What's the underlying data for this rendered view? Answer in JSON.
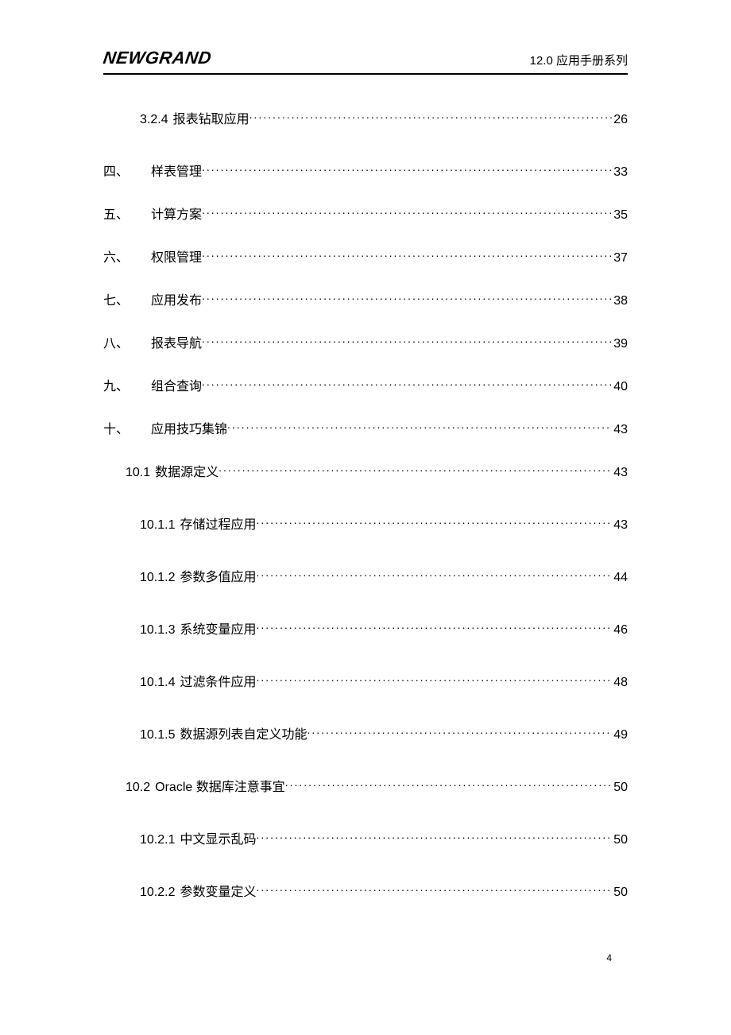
{
  "header": {
    "logo": "NEWGRAND",
    "right": "12.0 应用手册系列"
  },
  "toc": [
    {
      "level": 3,
      "num": "3.2.4",
      "title": "报表钻取应用",
      "page": "26"
    },
    {
      "level": 1,
      "prefix": "四、",
      "title": "样表管理",
      "page": "33"
    },
    {
      "level": 1,
      "prefix": "五、",
      "title": "计算方案",
      "page": "35"
    },
    {
      "level": 1,
      "prefix": "六、",
      "title": "权限管理",
      "page": "37"
    },
    {
      "level": 1,
      "prefix": "七、",
      "title": "应用发布",
      "page": "38"
    },
    {
      "level": 1,
      "prefix": "八、",
      "title": "报表导航",
      "page": "39"
    },
    {
      "level": 1,
      "prefix": "九、",
      "title": "组合查询",
      "page": "40"
    },
    {
      "level": 1,
      "prefix": "十、",
      "title": "应用技巧集锦",
      "page": "43"
    },
    {
      "level": 2,
      "num": "10.1",
      "title": "数据源定义",
      "page": "43"
    },
    {
      "level": 3,
      "num": "10.1.1",
      "title": "存储过程应用",
      "page": "43"
    },
    {
      "level": 3,
      "num": "10.1.2",
      "title": "参数多值应用",
      "page": "44"
    },
    {
      "level": 3,
      "num": "10.1.3",
      "title": "系统变量应用",
      "page": "46"
    },
    {
      "level": 3,
      "num": "10.1.4",
      "title": "过滤条件应用",
      "page": "48"
    },
    {
      "level": 3,
      "num": "10.1.5",
      "title": "数据源列表自定义功能",
      "page": "49"
    },
    {
      "level": 2,
      "num": "10.2",
      "title": "Oracle 数据库注意事宜",
      "page": "50"
    },
    {
      "level": 3,
      "num": "10.2.1",
      "title": "中文显示乱码",
      "page": "50"
    },
    {
      "level": 3,
      "num": "10.2.2",
      "title": "参数变量定义",
      "page": "50"
    }
  ],
  "footer": {
    "page_num": "4"
  }
}
